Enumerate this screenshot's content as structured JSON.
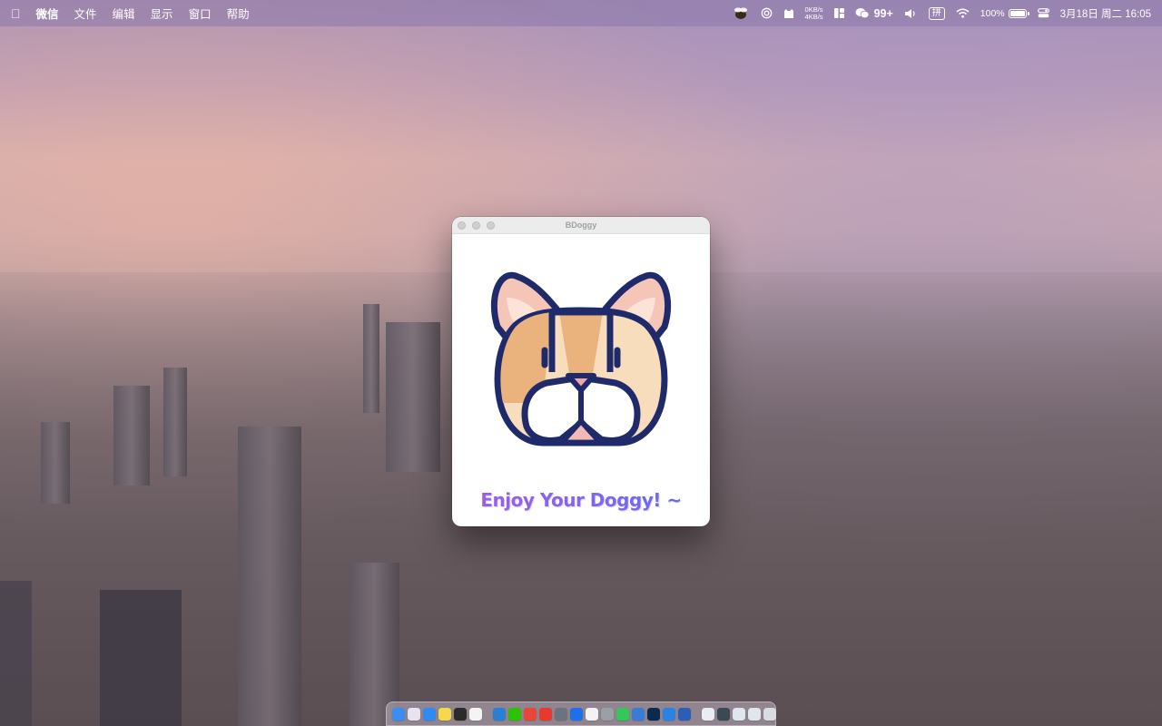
{
  "menubar": {
    "apple_icon": "apple-icon",
    "app_name": "微信",
    "items": [
      "文件",
      "编辑",
      "显示",
      "窗口",
      "帮助"
    ],
    "net_up": "0KB/s",
    "net_down": "4KB/s",
    "wechat_badge": "99+",
    "ime_label": "拼",
    "battery_percent": "100%",
    "datetime": "3月18日 周二  16:05"
  },
  "window": {
    "title": "BDoggy",
    "tagline": "Enjoy Your Doggy! ~",
    "dog_icon": "french-bulldog-icon"
  },
  "dock": {
    "apps": [
      {
        "name": "finder-icon",
        "color": "#3b8ef0"
      },
      {
        "name": "launchpad-icon",
        "color": "#e8e3f0"
      },
      {
        "name": "safari-icon",
        "color": "#2f8bf2"
      },
      {
        "name": "notes-icon",
        "color": "#f5d94a"
      },
      {
        "name": "terminal-icon",
        "color": "#2b2b2b"
      },
      {
        "name": "notion-icon",
        "color": "#f4f4f4"
      },
      {
        "name": "vscode-icon",
        "color": "#2a7fd4"
      },
      {
        "name": "wechat-icon",
        "color": "#2dc100"
      },
      {
        "name": "chrome-icon",
        "color": "#e9453a"
      },
      {
        "name": "app-red-icon",
        "color": "#e6392f"
      },
      {
        "name": "app-gray-icon",
        "color": "#6b7280"
      },
      {
        "name": "app-blue-icon",
        "color": "#1f6feb"
      },
      {
        "name": "app-white-icon",
        "color": "#f3f3f3"
      },
      {
        "name": "settings-icon",
        "color": "#9aa0a6"
      },
      {
        "name": "messages-icon",
        "color": "#34c759"
      },
      {
        "name": "xcode-icon",
        "color": "#3a7bd5"
      },
      {
        "name": "photoshop-icon",
        "color": "#0a2a4f"
      },
      {
        "name": "app-blue2-icon",
        "color": "#2a82e4"
      },
      {
        "name": "word-icon",
        "color": "#2b5eb7"
      },
      {
        "name": "folder-icon",
        "color": "#e9eef5"
      },
      {
        "name": "screen-icon",
        "color": "#3a4a55"
      },
      {
        "name": "window-icon",
        "color": "#dfe6ee"
      },
      {
        "name": "window2-icon",
        "color": "#dfe6ee"
      },
      {
        "name": "trash-icon",
        "color": "#d9dde2"
      }
    ]
  }
}
